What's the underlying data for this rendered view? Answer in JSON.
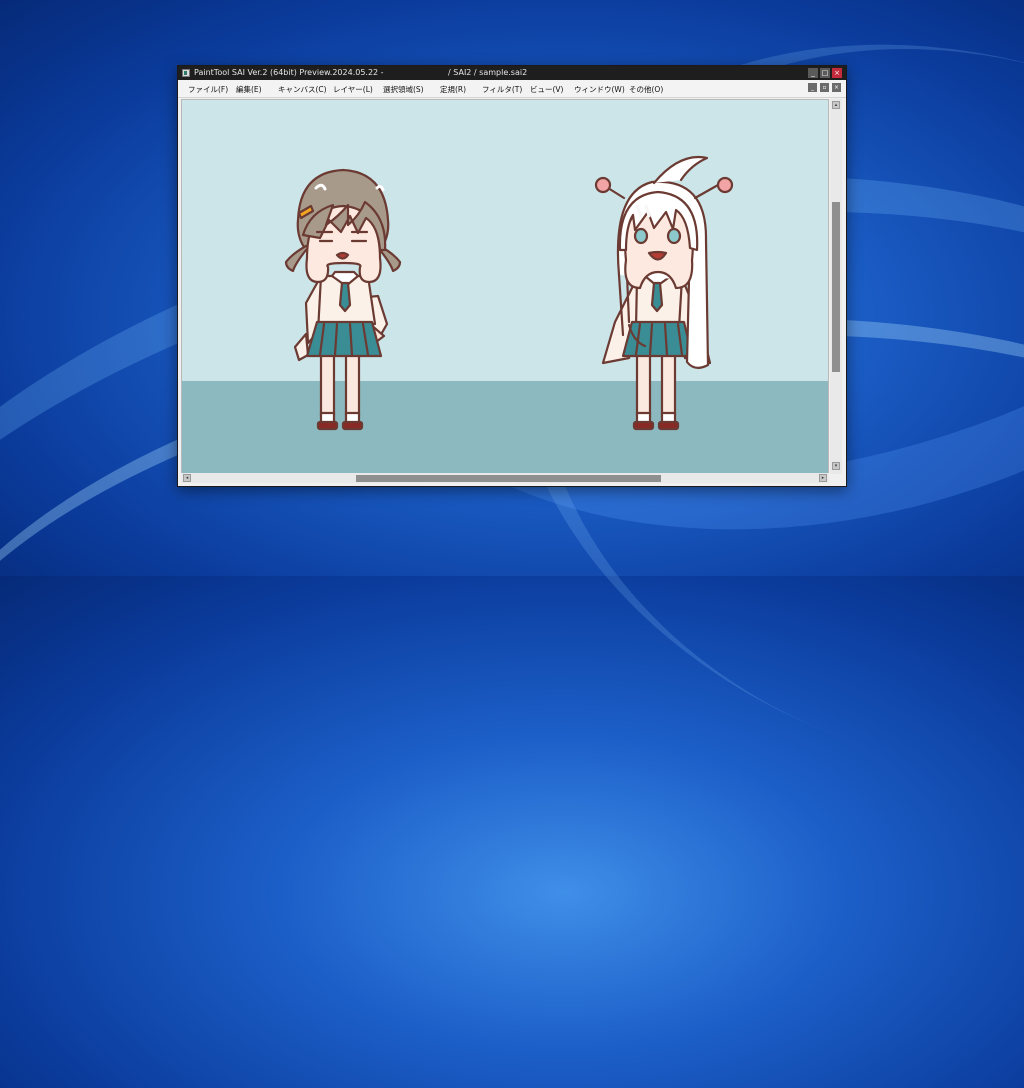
{
  "window": {
    "title_left": "PaintTool SAI Ver.2 (64bit) Preview.2024.05.22 -",
    "title_right": "/ SAI2 / sample.sai2",
    "controls": {
      "minimize": "_",
      "maximize": "□",
      "close": "×"
    }
  },
  "menu": {
    "items": [
      "ファイル(F)",
      "編集(E)",
      "キャンバス(C)",
      "レイヤー(L)",
      "選択領域(S)",
      "定規(R)",
      "フィルタ(T)",
      "ビュー(V)",
      "ウィンドウ(W)",
      "その他(O)"
    ],
    "doc_controls": {
      "minimize": "_",
      "restore": "▫",
      "close": "×"
    }
  },
  "canvas": {
    "background_color": "#cce5e9",
    "floor_color": "#8cb8bf",
    "skirt_color": "#3a8c95",
    "hair_color_left": "#a89a8a",
    "outline_color": "#6b3a32"
  },
  "scrollbars": {
    "up": "▴",
    "down": "▾",
    "left": "◂",
    "right": "▸"
  }
}
